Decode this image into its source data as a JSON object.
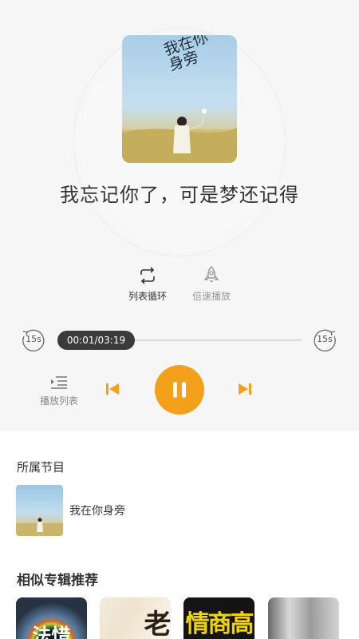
{
  "player": {
    "cover": {
      "title_art": "我在你身旁"
    },
    "track_title": "我忘记你了，可是梦还记得",
    "modes": {
      "loop_label": "列表循环",
      "speed_label": "倍速播放"
    },
    "skip_back_label": "15s",
    "skip_forward_label": "15s",
    "time_display": "00:01/03:19",
    "progress": 0.005,
    "playlist_label": "播放列表",
    "colors": {
      "accent": "#f5a01a",
      "pill": "#3b3b3b"
    },
    "icons": {
      "loop": "repeat-icon",
      "speed": "rocket-icon",
      "playlist": "playlist-icon",
      "prev": "skip-previous-icon",
      "next": "skip-next-icon",
      "pause": "pause-icon"
    }
  },
  "program": {
    "section_label": "所属节目",
    "name": "我在你身旁"
  },
  "similar": {
    "section_label": "相似专辑推荐",
    "albums": [
      {
        "cover_text": "法惜"
      },
      {
        "cover_text": "老"
      },
      {
        "cover_text": "情商高"
      },
      {
        "cover_text": ""
      }
    ]
  }
}
